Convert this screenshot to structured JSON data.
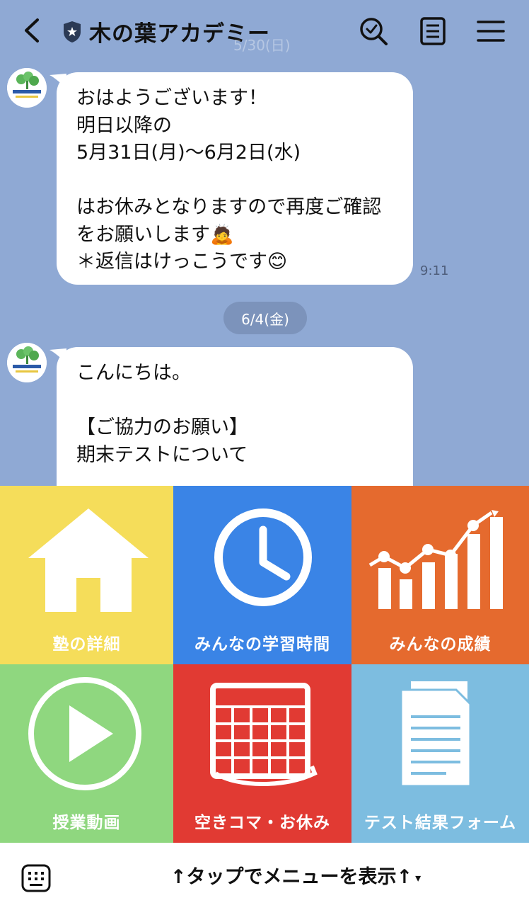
{
  "header": {
    "title": "木の葉アカデミー",
    "back_icon": "chevron-left-icon",
    "search_icon": "search-icon",
    "notes_icon": "notes-icon",
    "menu_icon": "hamburger-icon",
    "ghost_date": "5/30(日)"
  },
  "chat": {
    "messages": [
      {
        "text": "おはようございます！\n明日以降の\n5月31日(月)〜6月2日(水)\n\nはお休みとなりますので再度ご確認をお願いします🙇\n＊返信はけっこうです😊",
        "time": "9:11"
      },
      {
        "text": "こんにちは。\n\n【ご協力のお願い】\n期末テストについて",
        "time": ""
      }
    ],
    "date_separator": "6/4(金)"
  },
  "menu": {
    "tiles": [
      {
        "label": "塾の詳細",
        "icon": "house-icon",
        "color": "#f5dd5a"
      },
      {
        "label": "みんなの学習時間",
        "icon": "clock-icon",
        "color": "#3a84e6"
      },
      {
        "label": "みんなの成績",
        "icon": "bar-chart-icon",
        "color": "#e56a2e"
      },
      {
        "label": "授業動画",
        "icon": "play-icon",
        "color": "#8fd77f"
      },
      {
        "label": "空きコマ・お休み",
        "icon": "calendar-icon",
        "color": "#e13a33"
      },
      {
        "label": "テスト結果フォーム",
        "icon": "document-icon",
        "color": "#7dbde0"
      }
    ]
  },
  "bottombar": {
    "keyboard_icon": "keyboard-icon",
    "toggle_label": "↑タップでメニューを表示↑",
    "caret": "▾"
  }
}
